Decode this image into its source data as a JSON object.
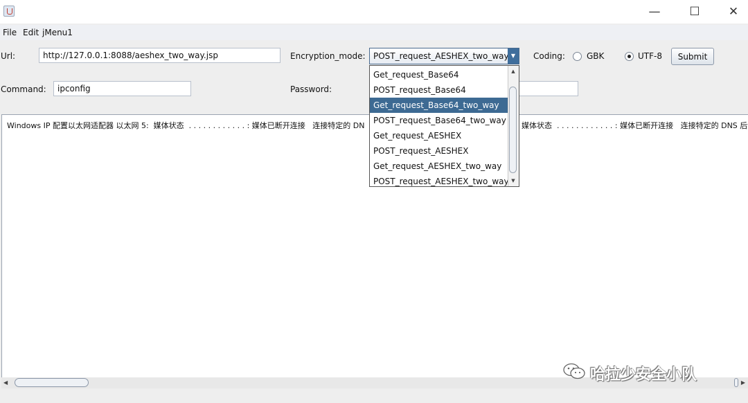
{
  "window": {
    "minimize_glyph": "—",
    "maximize_glyph": "☐",
    "close_glyph": "✕"
  },
  "menu": [
    "File",
    "Edit",
    "jMenu1"
  ],
  "url": {
    "label": "Url:",
    "value": "http://127.0.0.1:8088/aeshex_two_way.jsp"
  },
  "command": {
    "label": "Command:",
    "value": "ipconfig"
  },
  "encryption": {
    "label": "Encryption_mode:",
    "selected": "POST_request_AESHEX_two_way",
    "options": [
      "Get_request_Base64",
      "POST_request_Base64",
      "Get_request_Base64_two_way",
      "POST_request_Base64_two_way",
      "Get_request_AESHEX",
      "POST_request_AESHEX",
      "Get_request_AESHEX_two_way",
      "POST_request_AESHEX_two_way"
    ],
    "highlighted_index": 2
  },
  "password": {
    "label": "Password:",
    "value": ""
  },
  "coding": {
    "label": "Coding:",
    "options": [
      "GBK",
      "UTF-8"
    ],
    "selected": "UTF-8"
  },
  "submit_label": "Submit",
  "output": {
    "left_text": "Windows IP 配置以太网适配器 以太网 5:  媒体状态  . . . . . . . . . . . . : 媒体已断开连接   连接特定的 DN",
    "right_text": "媒体状态  . . . . . . . . . . . . : 媒体已断开连接   连接特定的 DNS 后缀"
  },
  "watermark": "哈拉少安全小队",
  "icons": {
    "app": "java-cup-icon",
    "combo_arrow": "chevron-down-icon",
    "watermark_logo": "wechat-icon"
  }
}
